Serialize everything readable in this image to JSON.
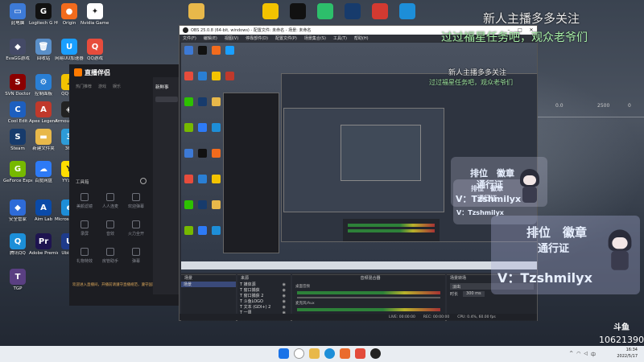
{
  "desktop": {
    "icons": [
      {
        "label": "此电脑",
        "color": "#3d7ad6",
        "glyph": "▭"
      },
      {
        "label": "Logitech G HUB",
        "color": "#111111",
        "glyph": "G"
      },
      {
        "label": "Origin",
        "color": "#f26b1d",
        "glyph": "●"
      },
      {
        "label": "Nvidia Game Client",
        "color": "#ffffff",
        "glyph": "✦"
      },
      {
        "label": "EvaGG游戏",
        "color": "#444a66",
        "glyph": "◆"
      },
      {
        "label": "回收站",
        "color": "#5a8fc8",
        "glyph": "🗑"
      },
      {
        "label": "网易UU加速器",
        "color": "#1a9fff",
        "glyph": "U"
      },
      {
        "label": "QQ游戏",
        "color": "#e74c3c",
        "glyph": "Q"
      },
      {
        "label": "SVN Doctor",
        "color": "#8b0000",
        "glyph": "S"
      },
      {
        "label": "控制面板",
        "color": "#2a7fd4",
        "glyph": "⚙"
      },
      {
        "label": "QQ音乐",
        "color": "#f3c300",
        "glyph": "♪"
      },
      {
        "label": "Windows 11 Upgrade",
        "color": "#111111",
        "glyph": "▮"
      },
      {
        "label": "Cool Edit",
        "color": "#1d5fbf",
        "glyph": "C"
      },
      {
        "label": "Apex Legends",
        "color": "#c0392b",
        "glyph": "A"
      },
      {
        "label": "Armoury Crate",
        "color": "#222222",
        "glyph": "◈"
      },
      {
        "label": "微信",
        "color": "#2dc100",
        "glyph": "W"
      },
      {
        "label": "Steam",
        "color": "#173b6c",
        "glyph": "S"
      },
      {
        "label": "新建文件夹",
        "color": "#e8b84a",
        "glyph": "▬"
      },
      {
        "label": "360",
        "color": "#2d9bd8",
        "glyph": "3"
      },
      {
        "label": "Photoshop",
        "color": "#062b4f",
        "glyph": "Ps"
      },
      {
        "label": "GeForce Experience",
        "color": "#76b900",
        "glyph": "G"
      },
      {
        "label": "百度网盘",
        "color": "#2d7af6",
        "glyph": "☁"
      },
      {
        "label": "YY语音",
        "color": "#ffdd00",
        "glyph": "Y"
      },
      {
        "label": "完美世界",
        "color": "#222222",
        "glyph": "W"
      },
      {
        "label": "安全管家",
        "color": "#2e6bd8",
        "glyph": "◆"
      },
      {
        "label": "Aim Lab",
        "color": "#0a4aa8",
        "glyph": "A"
      },
      {
        "label": "Microsoft Edge",
        "color": "#1d8ed8",
        "glyph": "e"
      },
      {
        "label": "Ubisoft Connect",
        "color": "#2255aa",
        "glyph": "U"
      },
      {
        "label": "腾讯QQ",
        "color": "#1c8fd8",
        "glyph": "Q"
      },
      {
        "label": "Adobe Premiere",
        "color": "#1e1450",
        "glyph": "Pr"
      },
      {
        "label": "Ubisoft",
        "color": "#1e3b8a",
        "glyph": "U"
      },
      {
        "label": "网易云音乐",
        "color": "#d33a31",
        "glyph": "♫"
      },
      {
        "label": "TGP",
        "color": "#5a3f82",
        "glyph": "T"
      }
    ]
  },
  "liveapp": {
    "title": "直播伴侣",
    "tabs": [
      "热门推荐",
      "游戏",
      "娱乐"
    ],
    "panel_title": "新鲜事",
    "tools_title": "工具箱",
    "tools": [
      "美颜滤镜",
      "人人连麦",
      "欢迎弹幕",
      "录屏",
      "音效",
      "火力全开",
      "礼物特效",
      "房管助手",
      "弹幕"
    ],
    "notice": "欢迎进入直播间，开播前请遵守直播规范，遵守国家法律法规。"
  },
  "obs": {
    "title": "OBS 25.0.8 (64-bit, windows) - 配置文件: 未命名 - 场景: 未命名",
    "menu": [
      "文件(F)",
      "编辑(E)",
      "视图(V)",
      "停靠部件(D)",
      "配置文件(P)",
      "场景集合(S)",
      "工具(T)",
      "帮助(H)"
    ],
    "docks": {
      "scenes": {
        "title": "场景",
        "items": [
          "场景"
        ]
      },
      "sources": {
        "title": "来源",
        "items": [
          "T 媒体源",
          "T 窗口捕获",
          "T 窗口捕获 2",
          "T 斗鱼LOGO",
          "T 文本 (GDI+) 2",
          "T 一周",
          "T 主播吐槽2"
        ]
      },
      "mixer": {
        "title": "音频混合器",
        "tracks": [
          {
            "name": "桌面音频",
            "level": "0.0 dB"
          },
          {
            "name": "麦克风/Aux",
            "level": "0.0 dB"
          }
        ]
      },
      "transitions": {
        "title": "场景转场",
        "mode": "淡出",
        "duration_label": "时长",
        "duration": "300 ms"
      }
    },
    "status": {
      "live": "LIVE: 00:00:00",
      "rec": "REC: 00:00:00",
      "cpu": "CPU: 0.4%, 60.00 fps"
    }
  },
  "overlay": {
    "top_title": "新人主播多多关注",
    "top_sub": "过过福星任务吧，观众老爷们",
    "panel_title": "排位　徽章",
    "panel_sub": "通行证",
    "panel_contact": "V：Tzshmilyx",
    "stat_a": "0.0",
    "stat_b": "2500",
    "stat_c": "0"
  },
  "watermark": {
    "logo": "斗鱼",
    "room_id": "10621390"
  },
  "taskbar": {
    "time": "16:34",
    "date": "2022/5/17",
    "lang": "中",
    "tray_extra": "^"
  }
}
